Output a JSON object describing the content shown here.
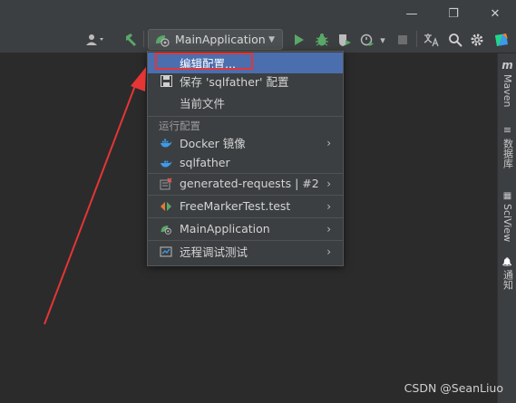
{
  "window_controls": {
    "minimize": "—",
    "restore": "❐",
    "close": "✕"
  },
  "toolbar": {
    "run_config_label": "MainApplication",
    "run_config_arrow": "▼",
    "more_arrow": "▾"
  },
  "menu": {
    "top_items": [
      {
        "label": "编辑配置..."
      },
      {
        "label": "保存 'sqlfather' 配置"
      },
      {
        "label": "当前文件"
      }
    ],
    "section_title": "运行配置",
    "configs": [
      {
        "label": "Docker 镜像"
      },
      {
        "label": "sqlfather"
      },
      {
        "label": "generated-requests | #2"
      },
      {
        "label": "FreeMarkerTest.test"
      },
      {
        "label": "MainApplication"
      },
      {
        "label": "远程调试测试"
      }
    ],
    "chevron": "›"
  },
  "right_panel": {
    "tabs": [
      {
        "label": "Maven",
        "icon_char": "m"
      },
      {
        "label": "数据库",
        "icon_char": "≡"
      },
      {
        "label": "SciView",
        "icon_char": "▦"
      },
      {
        "label": "通知",
        "icon_char": "🔔"
      }
    ]
  },
  "watermark": "CSDN @SeanLiuo",
  "colors": {
    "accent_selection": "#4b6eaf",
    "highlight_box": "#e53535",
    "annotation_arrow": "#e53535",
    "run_green": "#59a869"
  }
}
